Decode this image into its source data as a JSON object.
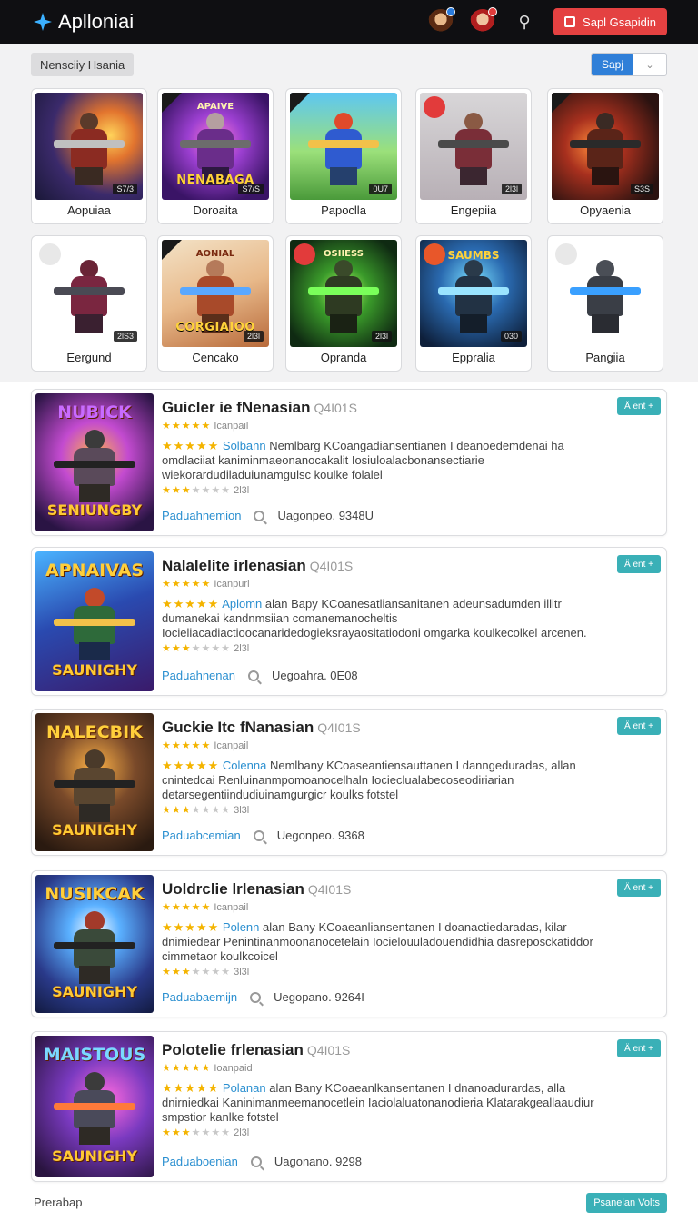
{
  "header": {
    "app_name": "Aplloniai",
    "cta_label": "Sapl Gsapidin",
    "colors": {
      "bar": "#0f0f12",
      "cta": "#e44141",
      "accent": "#3bb0ff"
    }
  },
  "filters": {
    "chip_label": "Nensciiy Hsania",
    "sort_label": "Sapj"
  },
  "tiles": [
    {
      "label": "Aopuiaa",
      "badge": "S7/3",
      "art_text": "",
      "art_top": ""
    },
    {
      "label": "Doroaita",
      "badge": "S7/S",
      "art_text": "NENABAGA",
      "art_top": "APAIVE"
    },
    {
      "label": "Papoclla",
      "badge": "0U7",
      "art_text": "",
      "art_top": ""
    },
    {
      "label": "Engepiia",
      "badge": "2l3l",
      "art_text": "",
      "art_top": ""
    },
    {
      "label": "Opyaenia",
      "badge": "S3S",
      "art_text": "",
      "art_top": ""
    },
    {
      "label": "Eergund",
      "badge": "2lS3",
      "art_text": "",
      "art_top": ""
    },
    {
      "label": "Cencako",
      "badge": "2l3l",
      "art_text": "CORGIAIOO",
      "art_top": "AONIAL"
    },
    {
      "label": "Opranda",
      "badge": "2l3l",
      "art_text": "",
      "art_top": "OSIIESS"
    },
    {
      "label": "Eppralia",
      "badge": "030",
      "art_text": "",
      "art_top": "SAUMBS"
    },
    {
      "label": "Pangiia",
      "badge": "",
      "art_text": "",
      "art_top": ""
    }
  ],
  "cards": [
    {
      "title": "Guicler ie fNenasian",
      "title_meta": "Q4I01S",
      "small": "Icanpail",
      "highlight": "Solbann",
      "desc": "Nemlbarg KCoangadiansentianen I deanoedemdenai ha omdlaciiat kaniminmaeonanocakalit Iosiuloalacbonansectiarie wiekorardudiladuiunamgulsc koulke folalel",
      "rating_count": "2l3l",
      "link": "Paduahnemion",
      "value": "Uagonpeo. 9348U",
      "cover_top": "NUBICK",
      "cover_bottom": "SENIUNGBY",
      "tag": "Ä ent +"
    },
    {
      "title": "Nalalelite irlenasian",
      "title_meta": "Q4I01S",
      "small": "Icanpuri",
      "highlight": "Aplomn",
      "desc": "alan Bapy KCoanesatliansanitanen adeunsadumden illitr dumanekai kandnmsiian comanemanocheltis Iocieliacadiactioocanaridedogieksrayaositatiodoni omgarka koulkecolkel arcenen.",
      "rating_count": "2l3l",
      "link": "Paduahnenan",
      "value": "Uegoahra. 0E08",
      "cover_top": "APNAIVAS",
      "cover_bottom": "SAUNIGHY",
      "tag": "Ä ent +"
    },
    {
      "title": "Guckie Itc fNanasian",
      "title_meta": "Q4I01S",
      "small": "Icanpail",
      "highlight": "Colenna",
      "desc": "Nemlbany KCoaseantiensauttanen I danngeduradas, allan cnintedcai Renluinanmpomoanocelhaln Iocieclualabecoseodiriarian detarsegentiindudiuinamgurgicr koulks fotstel",
      "rating_count": "3l3l",
      "link": "Paduabcemian",
      "value": "Uegonpeo. 9368",
      "cover_top": "NALECBIK",
      "cover_bottom": "SAUNIGHY",
      "tag": "Ä ent +"
    },
    {
      "title": "Uoldrclie lrlenasian",
      "title_meta": "Q4I01S",
      "small": "Icanpail",
      "highlight": "Polenn",
      "desc": "alan Bany KCoaeanliansentanen I doanactiedaradas, kilar dnimiedear Penintinanmoonanocetelain Iocielouuladouendidhia dasreposckatiddor cimmetaor koulkcoicel",
      "rating_count": "3l3l",
      "link": "Paduabaemijn",
      "value": "Uegopano. 9264I",
      "cover_top": "NUSIKCAK",
      "cover_bottom": "SAUNIGHY",
      "tag": "Ä ent +"
    },
    {
      "title": "Polotelie frlenasian",
      "title_meta": "Q4I01S",
      "small": "Ioanpaid",
      "highlight": "Polanan",
      "desc": "alan Bany KCoaeanlkansentanen I dnanoadurardas, alla dnirniedkai Kaninimanmeemanocetlein Iaciolaluatonanodieria Klatarakgeallaaudiur smpstior kanlke fotstel",
      "rating_count": "2l3l",
      "link": "Paduaboenian",
      "value": "Uagonano. 9298",
      "cover_top": "MAISTOUS",
      "cover_bottom": "SAUNIGHY",
      "tag": "Ä ent +"
    }
  ],
  "footer": {
    "left": "Prerabap",
    "button": "Psanelan Volts"
  }
}
